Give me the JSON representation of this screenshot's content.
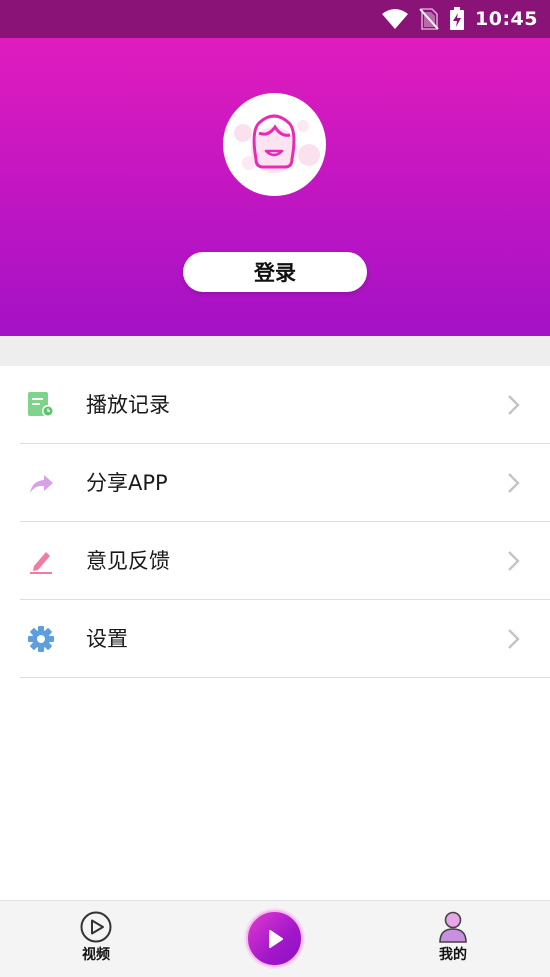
{
  "status_bar": {
    "time": "10:45",
    "icons": [
      "wifi-icon",
      "no-sim-icon",
      "battery-charging-icon"
    ],
    "background": "#8a1378"
  },
  "header": {
    "gradient_top": "#e01cbd",
    "gradient_bottom": "#a412c6",
    "avatar_icon": "girl-avatar-icon",
    "login_label": "登录"
  },
  "menu": {
    "items": [
      {
        "label": "播放记录",
        "icon": "play-history-icon",
        "icon_color": "#6fcf7e"
      },
      {
        "label": "分享APP",
        "icon": "share-icon",
        "icon_color": "#d58be6"
      },
      {
        "label": "意见反馈",
        "icon": "edit-pencil-icon",
        "icon_color": "#f06a99"
      },
      {
        "label": "设置",
        "icon": "gear-icon",
        "icon_color": "#5c9ee0"
      }
    ]
  },
  "bottom_nav": {
    "tabs": [
      {
        "label": "视频",
        "icon": "video-play-circle-icon"
      },
      {
        "label": "我的",
        "icon": "profile-icon"
      }
    ],
    "center_button_icon": "play-icon",
    "accent": "#a217c9"
  }
}
